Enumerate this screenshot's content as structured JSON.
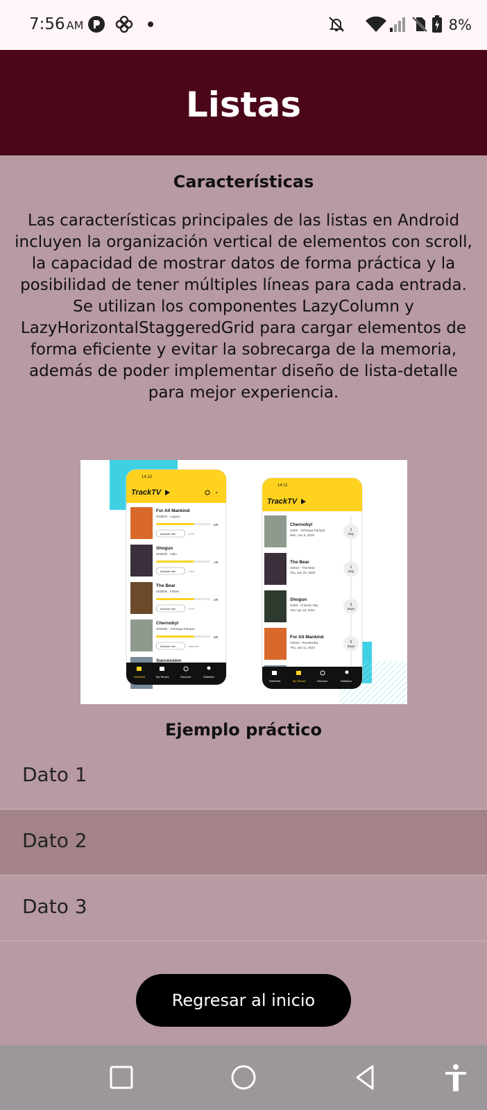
{
  "status_bar": {
    "time": "7:56",
    "ampm": "AM",
    "battery": "8%"
  },
  "app_bar": {
    "title": "Listas"
  },
  "features": {
    "title": "Características",
    "description": "Las características principales de las listas en Android incluyen la organización vertical de elementos con scroll, la capacidad de mostrar datos de forma práctica y la posibilidad de tener múltiples líneas para cada entrada. Se utilizan los componentes LazyColumn y LazyHorizontalStaggeredGrid para cargar elementos de forma eficiente y evitar la sobrecarga de la memoria, además de poder implementar diseño de lista-detalle para mejor experiencia."
  },
  "illustration": {
    "left_phone": {
      "time": "14:10",
      "logo": "TrackTV",
      "items": [
        {
          "title": "For All Mankind",
          "sub": "S04E03 · Legacy",
          "count": "4/8",
          "btn": "Episode Info",
          "left": "4 left"
        },
        {
          "title": "Shogun",
          "sub": "S02E05 · Anjin",
          "count": "1/8",
          "btn": "Episode Info",
          "left": "7 left"
        },
        {
          "title": "The Bear",
          "sub": "S02E06 · Fishes",
          "count": "2/8",
          "btn": "Episode Info",
          "left": "3 left"
        },
        {
          "title": "Chernobyl",
          "sub": "S01E05 · Vichnaya Pamyat",
          "count": "5/5",
          "btn": "Episode Info",
          "left": "watched"
        },
        {
          "title": "Succession",
          "sub": "",
          "count": "",
          "btn": "",
          "left": ""
        }
      ],
      "nav": [
        "Watchlist",
        "My Shows",
        "Discover",
        "Statistics"
      ]
    },
    "right_phone": {
      "time": "14:11",
      "logo": "TrackTV",
      "items": [
        {
          "title": "Chernobyl",
          "sub": "S1E5 · Vichnaya Pamyat",
          "date": "Mon, Jun 3, 2019",
          "badge_num": "1",
          "badge_unit": "Day"
        },
        {
          "title": "The Bear",
          "sub": "S2E10 · The Bear",
          "date": "Thu, Jun 22, 2023",
          "badge_num": "1",
          "badge_unit": "Day"
        },
        {
          "title": "Shogun",
          "sub": "S1E6 · Crimson Sky",
          "date": "Tue, Apr 16, 2024",
          "badge_num": "3",
          "badge_unit": "Days"
        },
        {
          "title": "For All Mankind",
          "sub": "S4E10 · Perestroika",
          "date": "Thu, Jan 11, 2024",
          "badge_num": "5",
          "badge_unit": "Days"
        }
      ],
      "nav": [
        "Watchlist",
        "My Shows",
        "Discover",
        "Statistics"
      ]
    }
  },
  "example": {
    "title": "Ejemplo práctico",
    "items": [
      "Dato 1",
      "Dato 2",
      "Dato 3"
    ],
    "selected_index": 1
  },
  "back_button": {
    "label": "Regresar al inicio"
  },
  "colors": {
    "app_bar": "#4b0719",
    "background": "#b89aa2",
    "selected_row": "#a38389",
    "accent_yellow": "#ffd21f",
    "accent_cyan": "#3fd0e4"
  }
}
